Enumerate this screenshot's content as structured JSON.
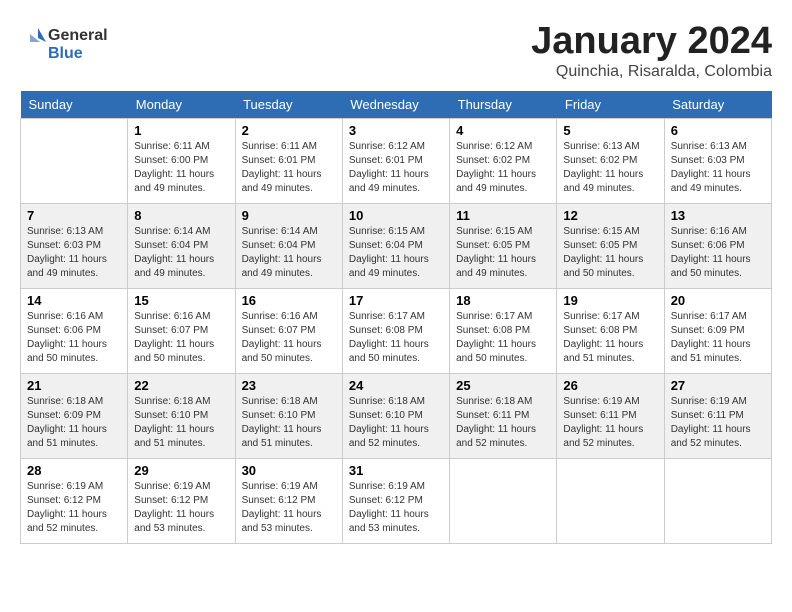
{
  "logo": {
    "general": "General",
    "blue": "Blue"
  },
  "title": "January 2024",
  "location": "Quinchia, Risaralda, Colombia",
  "days_header": [
    "Sunday",
    "Monday",
    "Tuesday",
    "Wednesday",
    "Thursday",
    "Friday",
    "Saturday"
  ],
  "weeks": [
    [
      {
        "day": "",
        "sunrise": "",
        "sunset": "",
        "daylight": ""
      },
      {
        "day": "1",
        "sunrise": "Sunrise: 6:11 AM",
        "sunset": "Sunset: 6:00 PM",
        "daylight": "Daylight: 11 hours and 49 minutes."
      },
      {
        "day": "2",
        "sunrise": "Sunrise: 6:11 AM",
        "sunset": "Sunset: 6:01 PM",
        "daylight": "Daylight: 11 hours and 49 minutes."
      },
      {
        "day": "3",
        "sunrise": "Sunrise: 6:12 AM",
        "sunset": "Sunset: 6:01 PM",
        "daylight": "Daylight: 11 hours and 49 minutes."
      },
      {
        "day": "4",
        "sunrise": "Sunrise: 6:12 AM",
        "sunset": "Sunset: 6:02 PM",
        "daylight": "Daylight: 11 hours and 49 minutes."
      },
      {
        "day": "5",
        "sunrise": "Sunrise: 6:13 AM",
        "sunset": "Sunset: 6:02 PM",
        "daylight": "Daylight: 11 hours and 49 minutes."
      },
      {
        "day": "6",
        "sunrise": "Sunrise: 6:13 AM",
        "sunset": "Sunset: 6:03 PM",
        "daylight": "Daylight: 11 hours and 49 minutes."
      }
    ],
    [
      {
        "day": "7",
        "sunrise": "Sunrise: 6:13 AM",
        "sunset": "Sunset: 6:03 PM",
        "daylight": "Daylight: 11 hours and 49 minutes."
      },
      {
        "day": "8",
        "sunrise": "Sunrise: 6:14 AM",
        "sunset": "Sunset: 6:04 PM",
        "daylight": "Daylight: 11 hours and 49 minutes."
      },
      {
        "day": "9",
        "sunrise": "Sunrise: 6:14 AM",
        "sunset": "Sunset: 6:04 PM",
        "daylight": "Daylight: 11 hours and 49 minutes."
      },
      {
        "day": "10",
        "sunrise": "Sunrise: 6:15 AM",
        "sunset": "Sunset: 6:04 PM",
        "daylight": "Daylight: 11 hours and 49 minutes."
      },
      {
        "day": "11",
        "sunrise": "Sunrise: 6:15 AM",
        "sunset": "Sunset: 6:05 PM",
        "daylight": "Daylight: 11 hours and 49 minutes."
      },
      {
        "day": "12",
        "sunrise": "Sunrise: 6:15 AM",
        "sunset": "Sunset: 6:05 PM",
        "daylight": "Daylight: 11 hours and 50 minutes."
      },
      {
        "day": "13",
        "sunrise": "Sunrise: 6:16 AM",
        "sunset": "Sunset: 6:06 PM",
        "daylight": "Daylight: 11 hours and 50 minutes."
      }
    ],
    [
      {
        "day": "14",
        "sunrise": "Sunrise: 6:16 AM",
        "sunset": "Sunset: 6:06 PM",
        "daylight": "Daylight: 11 hours and 50 minutes."
      },
      {
        "day": "15",
        "sunrise": "Sunrise: 6:16 AM",
        "sunset": "Sunset: 6:07 PM",
        "daylight": "Daylight: 11 hours and 50 minutes."
      },
      {
        "day": "16",
        "sunrise": "Sunrise: 6:16 AM",
        "sunset": "Sunset: 6:07 PM",
        "daylight": "Daylight: 11 hours and 50 minutes."
      },
      {
        "day": "17",
        "sunrise": "Sunrise: 6:17 AM",
        "sunset": "Sunset: 6:08 PM",
        "daylight": "Daylight: 11 hours and 50 minutes."
      },
      {
        "day": "18",
        "sunrise": "Sunrise: 6:17 AM",
        "sunset": "Sunset: 6:08 PM",
        "daylight": "Daylight: 11 hours and 50 minutes."
      },
      {
        "day": "19",
        "sunrise": "Sunrise: 6:17 AM",
        "sunset": "Sunset: 6:08 PM",
        "daylight": "Daylight: 11 hours and 51 minutes."
      },
      {
        "day": "20",
        "sunrise": "Sunrise: 6:17 AM",
        "sunset": "Sunset: 6:09 PM",
        "daylight": "Daylight: 11 hours and 51 minutes."
      }
    ],
    [
      {
        "day": "21",
        "sunrise": "Sunrise: 6:18 AM",
        "sunset": "Sunset: 6:09 PM",
        "daylight": "Daylight: 11 hours and 51 minutes."
      },
      {
        "day": "22",
        "sunrise": "Sunrise: 6:18 AM",
        "sunset": "Sunset: 6:10 PM",
        "daylight": "Daylight: 11 hours and 51 minutes."
      },
      {
        "day": "23",
        "sunrise": "Sunrise: 6:18 AM",
        "sunset": "Sunset: 6:10 PM",
        "daylight": "Daylight: 11 hours and 51 minutes."
      },
      {
        "day": "24",
        "sunrise": "Sunrise: 6:18 AM",
        "sunset": "Sunset: 6:10 PM",
        "daylight": "Daylight: 11 hours and 52 minutes."
      },
      {
        "day": "25",
        "sunrise": "Sunrise: 6:18 AM",
        "sunset": "Sunset: 6:11 PM",
        "daylight": "Daylight: 11 hours and 52 minutes."
      },
      {
        "day": "26",
        "sunrise": "Sunrise: 6:19 AM",
        "sunset": "Sunset: 6:11 PM",
        "daylight": "Daylight: 11 hours and 52 minutes."
      },
      {
        "day": "27",
        "sunrise": "Sunrise: 6:19 AM",
        "sunset": "Sunset: 6:11 PM",
        "daylight": "Daylight: 11 hours and 52 minutes."
      }
    ],
    [
      {
        "day": "28",
        "sunrise": "Sunrise: 6:19 AM",
        "sunset": "Sunset: 6:12 PM",
        "daylight": "Daylight: 11 hours and 52 minutes."
      },
      {
        "day": "29",
        "sunrise": "Sunrise: 6:19 AM",
        "sunset": "Sunset: 6:12 PM",
        "daylight": "Daylight: 11 hours and 53 minutes."
      },
      {
        "day": "30",
        "sunrise": "Sunrise: 6:19 AM",
        "sunset": "Sunset: 6:12 PM",
        "daylight": "Daylight: 11 hours and 53 minutes."
      },
      {
        "day": "31",
        "sunrise": "Sunrise: 6:19 AM",
        "sunset": "Sunset: 6:12 PM",
        "daylight": "Daylight: 11 hours and 53 minutes."
      },
      {
        "day": "",
        "sunrise": "",
        "sunset": "",
        "daylight": ""
      },
      {
        "day": "",
        "sunrise": "",
        "sunset": "",
        "daylight": ""
      },
      {
        "day": "",
        "sunrise": "",
        "sunset": "",
        "daylight": ""
      }
    ]
  ]
}
